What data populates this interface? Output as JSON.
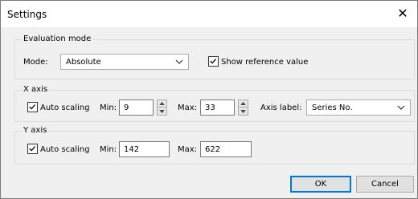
{
  "window": {
    "title": "Settings"
  },
  "evaluation": {
    "group_label": "Evaluation mode",
    "mode_label": "Mode:",
    "mode_value": "Absolute",
    "show_reference_label": "Show reference value",
    "show_reference_checked": true
  },
  "x_axis": {
    "group_label": "X axis",
    "auto_scaling_label": "Auto scaling",
    "auto_scaling_checked": true,
    "min_label": "Min:",
    "min_value": "9",
    "max_label": "Max:",
    "max_value": "33",
    "axis_label_label": "Axis label:",
    "axis_label_value": "Series No."
  },
  "y_axis": {
    "group_label": "Y axis",
    "auto_scaling_label": "Auto scaling",
    "auto_scaling_checked": true,
    "min_label": "Min:",
    "min_value": "142",
    "max_label": "Max:",
    "max_value": "622"
  },
  "buttons": {
    "ok": "OK",
    "cancel": "Cancel"
  },
  "colors": {
    "accent": "#0078d7",
    "dialog_bg": "#f0f0f0"
  }
}
